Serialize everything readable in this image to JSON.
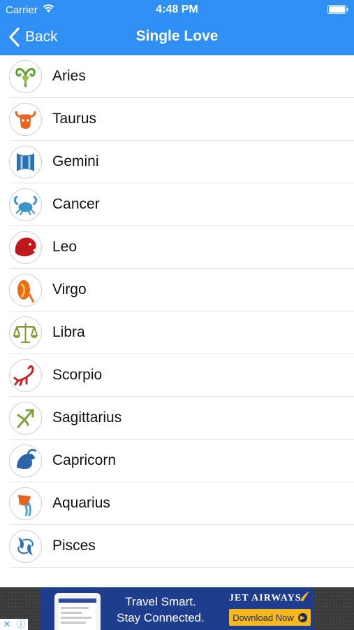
{
  "status_bar": {
    "carrier": "Carrier",
    "time": "4:48 PM"
  },
  "nav": {
    "back_label": "Back",
    "title": "Single Love"
  },
  "signs": [
    {
      "label": "Aries",
      "icon": "aries-icon",
      "color": "#5f9e2e"
    },
    {
      "label": "Taurus",
      "icon": "taurus-icon",
      "color": "#e8651e"
    },
    {
      "label": "Gemini",
      "icon": "gemini-icon",
      "color": "#2a6fb0"
    },
    {
      "label": "Cancer",
      "icon": "cancer-icon",
      "color": "#3c95c8"
    },
    {
      "label": "Leo",
      "icon": "leo-icon",
      "color": "#c0181b"
    },
    {
      "label": "Virgo",
      "icon": "virgo-icon",
      "color": "#ec6a1a"
    },
    {
      "label": "Libra",
      "icon": "libra-icon",
      "color": "#7c9a2d"
    },
    {
      "label": "Scorpio",
      "icon": "scorpio-icon",
      "color": "#c82020"
    },
    {
      "label": "Sagittarius",
      "icon": "sagittarius-icon",
      "color": "#7fa23a"
    },
    {
      "label": "Capricorn",
      "icon": "capricorn-icon",
      "color": "#2c64a8"
    },
    {
      "label": "Aquarius",
      "icon": "aquarius-icon",
      "color": "#e2661c"
    },
    {
      "label": "Pisces",
      "icon": "pisces-icon",
      "color": "#2a73b6"
    }
  ],
  "ad": {
    "line1": "Travel Smart.",
    "line2": "Stay Connected.",
    "brand": "JET AIRWAYS",
    "cta": "Download Now",
    "close_glyph": "✕",
    "info_glyph": "ⓘ"
  },
  "colors": {
    "accent": "#2f8ff5",
    "ad_blue": "#1e3d8f",
    "ad_cta": "#f6b81d"
  }
}
